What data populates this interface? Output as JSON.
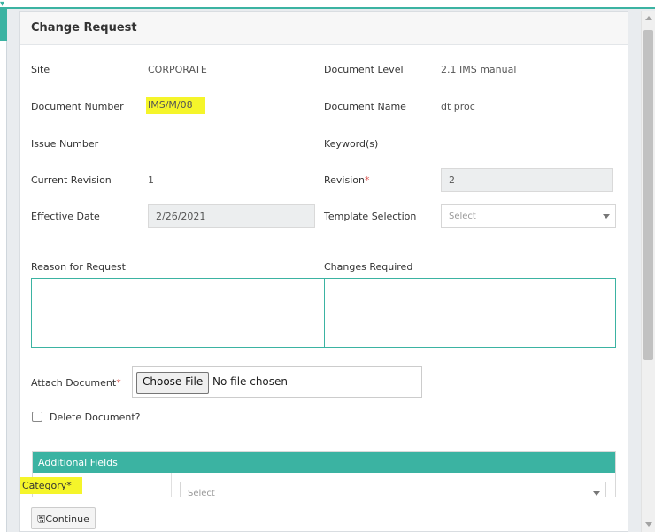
{
  "modal": {
    "title": "Change Request"
  },
  "fields": {
    "site": {
      "label": "Site",
      "value": "CORPORATE"
    },
    "document_level": {
      "label": "Document Level",
      "value": "2.1 IMS manual"
    },
    "document_number": {
      "label": "Document Number",
      "value": "IMS/M/08"
    },
    "document_name": {
      "label": "Document Name",
      "value": "dt proc"
    },
    "issue_number": {
      "label": "Issue Number",
      "value": ""
    },
    "keywords": {
      "label": "Keyword(s)",
      "value": ""
    },
    "current_revision": {
      "label": "Current Revision",
      "value": "1"
    },
    "revision": {
      "label": "Revision",
      "value": "2",
      "required_mark": "*"
    },
    "effective_date": {
      "label": "Effective Date",
      "value": "2/26/2021"
    },
    "template_selection": {
      "label": "Template Selection",
      "placeholder": "Select"
    },
    "reason_for_request": {
      "label": "Reason for Request",
      "value": ""
    },
    "changes_required": {
      "label": "Changes Required",
      "value": ""
    },
    "attach_document": {
      "label": "Attach Document",
      "required_mark": "*",
      "button_label": "Choose File",
      "status_text": "No file chosen"
    },
    "delete_document": {
      "label": "Delete Document?",
      "checked": false
    }
  },
  "additional_fields": {
    "title": "Additional Fields",
    "category": {
      "label": "Category*",
      "placeholder": "Select"
    }
  },
  "footer": {
    "continue_label": "Continue",
    "continue_icon": "save-icon"
  },
  "colors": {
    "accent": "#3bb3a2",
    "required": "#d9534f",
    "highlight": "#f5f52a"
  }
}
